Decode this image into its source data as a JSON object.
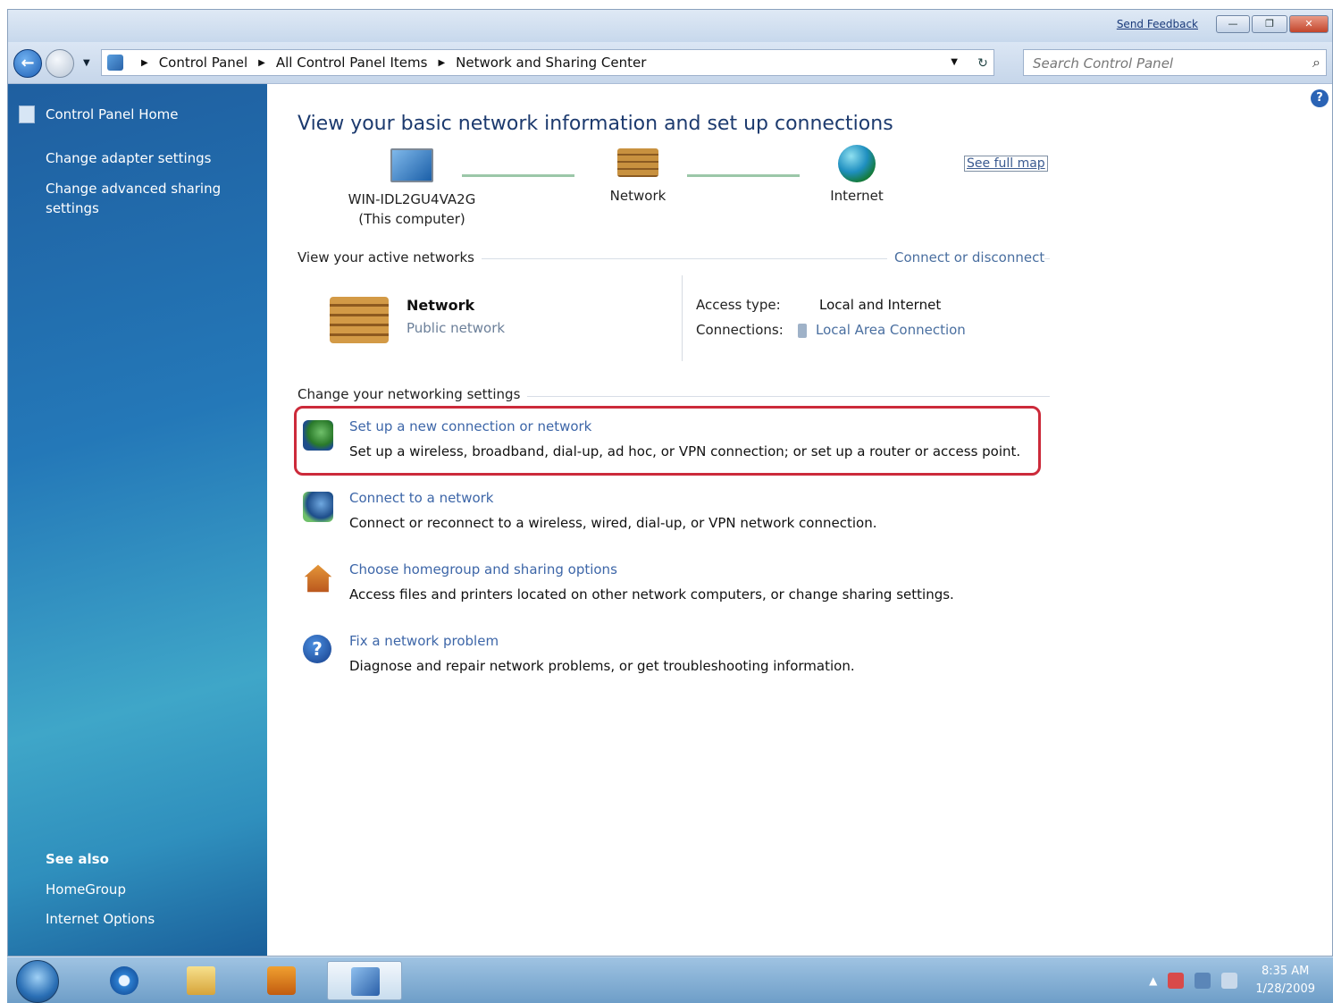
{
  "titlebar": {
    "feedback": "Send Feedback"
  },
  "address": {
    "crumbs": [
      "Control Panel",
      "All Control Panel Items",
      "Network and Sharing Center"
    ],
    "search_placeholder": "Search Control Panel"
  },
  "sidebar": {
    "home": "Control Panel Home",
    "links": [
      "Change adapter settings",
      "Change advanced sharing settings"
    ],
    "see_also": "See also",
    "see_also_links": [
      "HomeGroup",
      "Internet Options"
    ]
  },
  "main": {
    "heading": "View your basic network information and set up connections",
    "see_full_map": "See full map",
    "map": {
      "computer_name": "WIN-IDL2GU4VA2G",
      "computer_note": "(This computer)",
      "network": "Network",
      "internet": "Internet"
    },
    "active": {
      "title": "View your active networks",
      "connect_link": "Connect or disconnect",
      "network_name": "Network",
      "network_type": "Public network",
      "access_type_label": "Access type:",
      "access_type_value": "Local and Internet",
      "connections_label": "Connections:",
      "connections_value": "Local Area Connection"
    },
    "settings_title": "Change your networking settings",
    "tasks": [
      {
        "link": "Set up a new connection or network",
        "desc": "Set up a wireless, broadband, dial-up, ad hoc, or VPN connection; or set up a router or access point."
      },
      {
        "link": "Connect to a network",
        "desc": "Connect or reconnect to a wireless, wired, dial-up, or VPN network connection."
      },
      {
        "link": "Choose homegroup and sharing options",
        "desc": "Access files and printers located on other network computers, or change sharing settings."
      },
      {
        "link": "Fix a network problem",
        "desc": "Diagnose and repair network problems, or get troubleshooting information."
      }
    ],
    "highlight_color": "#cc2a3a"
  },
  "taskbar": {
    "time": "8:35 AM",
    "date": "1/28/2009"
  }
}
